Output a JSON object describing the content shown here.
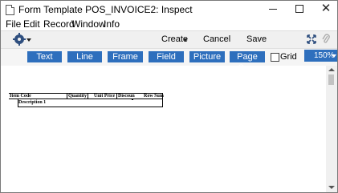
{
  "window": {
    "title": "Form Template POS_INVOICE2: Inspect"
  },
  "menubar": {
    "items": [
      "File",
      "Edit",
      "Record",
      "Window",
      "Info"
    ]
  },
  "toolbar": {
    "create_label": "Create",
    "cancel_label": "Cancel",
    "save_label": "Save"
  },
  "tools": {
    "items": [
      "Text",
      "Line",
      "Frame",
      "Field",
      "Picture",
      "Page Sum"
    ],
    "grid_label": "Grid",
    "grid_checked": false,
    "zoom_value": "150%"
  },
  "form": {
    "columns": [
      "Item Code",
      "Quantity",
      "Unit Price",
      "Discoun",
      "Row Sum"
    ],
    "row_field": "Description 1"
  },
  "colors": {
    "accent": "#2e6fbd",
    "toolbar_bg": "#f0f0f0",
    "icon": "#2f4f7f"
  }
}
